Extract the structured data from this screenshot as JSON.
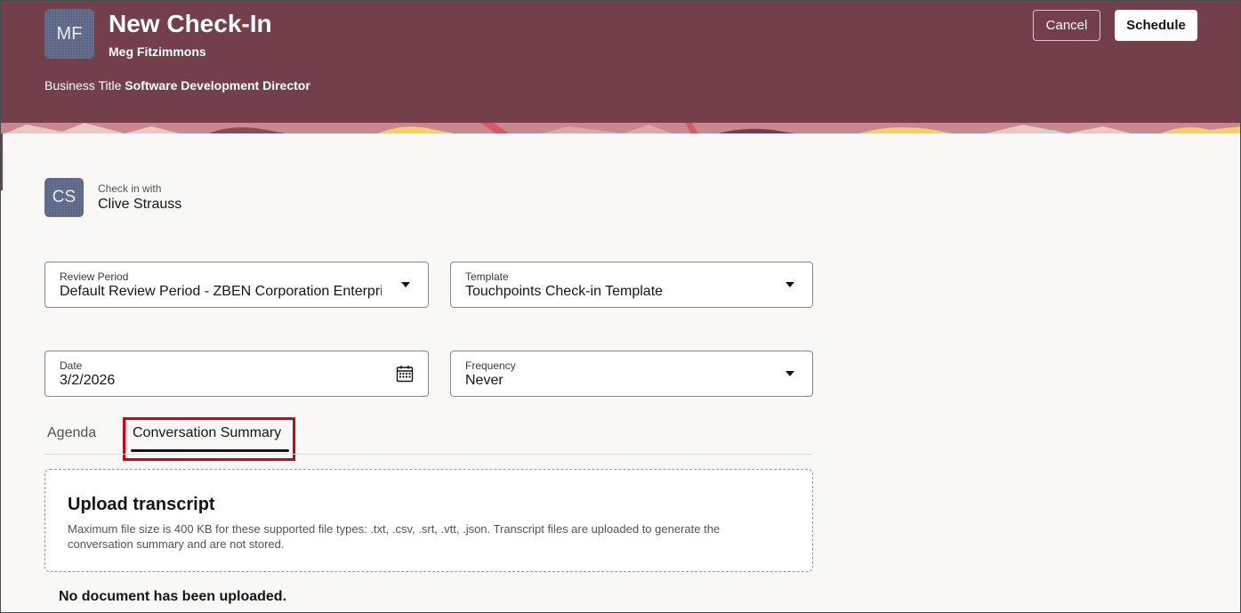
{
  "header": {
    "avatar_initials": "MF",
    "title": "New Check-In",
    "person_name": "Meg Fitzimmons",
    "business_title_label": "Business Title",
    "business_title_value": "Software Development Director",
    "cancel_label": "Cancel",
    "schedule_label": "Schedule",
    "background_color": "#733f4b"
  },
  "checkin": {
    "avatar_initials": "CS",
    "label": "Check in with",
    "name": "Clive Strauss"
  },
  "fields": {
    "review_period": {
      "label": "Review Period",
      "value": "Default Review Period - ZBEN Corporation Enterprise"
    },
    "template": {
      "label": "Template",
      "value": "Touchpoints Check-in Template"
    },
    "date": {
      "label": "Date",
      "value": "3/2/2026"
    },
    "frequency": {
      "label": "Frequency",
      "value": "Never"
    }
  },
  "tabs": [
    {
      "label": "Agenda",
      "selected": false
    },
    {
      "label": "Conversation Summary",
      "selected": true
    }
  ],
  "upload": {
    "title": "Upload transcript",
    "description": "Maximum file size is 400 KB for these supported file types: .txt, .csv, .srt, .vtt, .json. Transcript files are uploaded to generate the conversation summary and are not stored."
  },
  "status": {
    "no_document": "No document has been uploaded."
  },
  "icons": {
    "dropdown": "chevron-down-icon",
    "date": "calendar-icon"
  }
}
